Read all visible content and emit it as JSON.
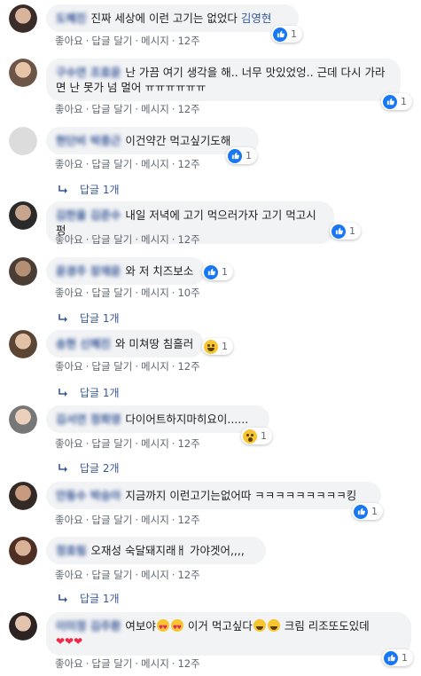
{
  "actions": {
    "like": "좋아요",
    "reply": "답글 달기",
    "message": "메시지",
    "dot": "·"
  },
  "comments": [
    {
      "author": "도혜진",
      "text": "진짜 세상에 이런 고기는 없었다",
      "mention": "김영현",
      "reaction": "like",
      "count": "1",
      "time": "12주",
      "replies": ""
    },
    {
      "author": "구수연 조효윤",
      "text": "난 가끔 여기 생각을 해.. 너무 맛있었엉.. 근데 다시 가라면 난 못가 넘 멀어 ㅠㅠㅠㅠㅠㅠ",
      "mention": "",
      "reaction": "like",
      "count": "1",
      "time": "12주",
      "replies": ""
    },
    {
      "author": "현단비 박종근",
      "text": "이건약간 먹고싶기도해",
      "mention": "",
      "reaction": "like",
      "count": "1",
      "time": "12주",
      "replies": "답글 1개"
    },
    {
      "author": "김한울 김준수",
      "text": "내일 저녁에 고기 먹으러가자 고기 먹고시펑",
      "mention": "",
      "reaction": "like",
      "count": "1",
      "time": "12주",
      "replies": ""
    },
    {
      "author": "윤경주 장재윤",
      "text": "와 저 치즈보소",
      "mention": "",
      "reaction": "like",
      "count": "1",
      "time": "10주",
      "replies": "답글 1개"
    },
    {
      "author": "송현 신혜진",
      "text": "와 미쳐땅 침흘러",
      "mention": "",
      "reaction": "haha",
      "count": "1",
      "time": "12주",
      "replies": "답글 1개"
    },
    {
      "author": "김서연 정희영",
      "text": "다이어트하지마히요이......",
      "mention": "",
      "reaction": "wow",
      "count": "1",
      "time": "12주",
      "replies": "답글 2개"
    },
    {
      "author": "안동수 박승아",
      "text": "지금까지 이런고기는없어따 ㅋㅋㅋㅋㅋㅋㅋㅋㅋ킹",
      "mention": "",
      "reaction": "like",
      "count": "1",
      "time": "12주",
      "replies": ""
    },
    {
      "author": "정효림",
      "text": "오재성 숙달돼지래ㅐ 가야겟어,,,,",
      "mention": "",
      "reaction": "",
      "count": "",
      "time": "12주",
      "replies": "답글 1개"
    },
    {
      "author": "이미정 김주환",
      "text_a": "여보야",
      "text_b": "이거 먹고싶다",
      "text_c": "크림 리조또도있데",
      "hearts": "❤❤❤",
      "reaction": "like",
      "count": "1",
      "time": "12주",
      "replies": ""
    }
  ],
  "colors": {
    "link": "#385898",
    "bubble": "#f2f3f5",
    "meta": "#606770",
    "like": "#1877f2"
  }
}
